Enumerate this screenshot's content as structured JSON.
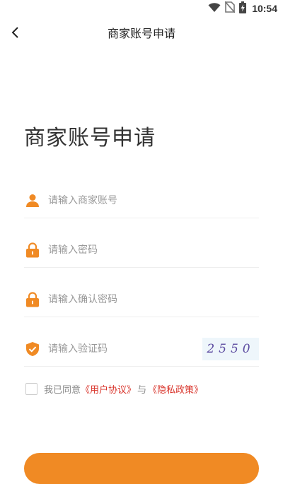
{
  "status_bar": {
    "time": "10:54",
    "icons": [
      "wifi-icon",
      "no-sim-icon",
      "battery-charging-icon"
    ]
  },
  "nav": {
    "back_icon": "back-arrow-icon",
    "title": "商家账号申请"
  },
  "page": {
    "heading": "商家账号申请"
  },
  "form": {
    "account": {
      "icon": "user-icon",
      "placeholder": "请输入商家账号",
      "value": ""
    },
    "password": {
      "icon": "lock-icon",
      "placeholder": "请输入密码",
      "value": ""
    },
    "confirm_password": {
      "icon": "lock-icon",
      "placeholder": "请输入确认密码",
      "value": ""
    },
    "captcha": {
      "icon": "shield-check-icon",
      "placeholder": "请输入验证码",
      "value": "",
      "code": "2550"
    }
  },
  "agreement": {
    "checked": false,
    "prefix": "我已同意",
    "user_agreement": "《用户协议》",
    "connector": "与",
    "privacy_policy": "《隐私政策》"
  },
  "colors": {
    "accent": "#f08a24",
    "link": "#d9342b",
    "divider": "#eeeeee"
  }
}
